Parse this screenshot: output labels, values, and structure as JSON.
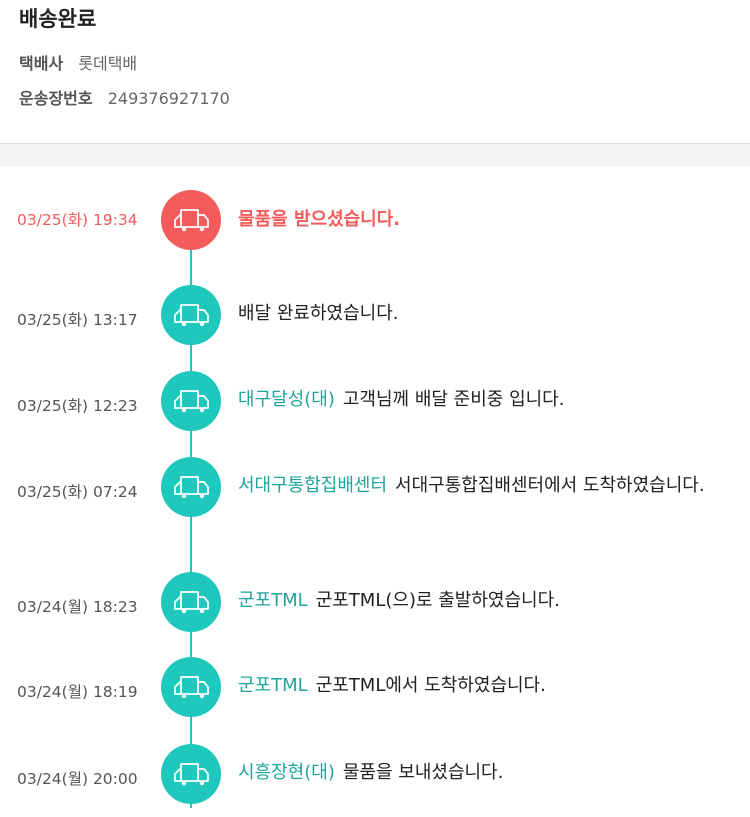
{
  "header": {
    "status_title": "배송완료",
    "carrier_label": "택배사",
    "carrier_value": "롯데택배",
    "tracking_label": "운송장번호",
    "tracking_value": "249376927170"
  },
  "colors": {
    "accent_teal": "#1fc8bd",
    "location_teal": "#1fa59c",
    "current_red": "#f45b5b"
  },
  "events": [
    {
      "time": "03/25(화) 19:34",
      "location": "",
      "message": "물품을 받으셨습니다.",
      "icon": "truck-icon",
      "current": true
    },
    {
      "time": "03/25(화) 13:17",
      "location": "",
      "message": "배달 완료하였습니다.",
      "icon": "truck-icon",
      "current": false
    },
    {
      "time": "03/25(화) 12:23",
      "location": "대구달성(대)",
      "message": "고객님께 배달 준비중 입니다.",
      "icon": "truck-icon",
      "current": false
    },
    {
      "time": "03/25(화) 07:24",
      "location": "서대구통합집배센터",
      "message": "서대구통합집배센터에서 도착하였습니다.",
      "icon": "truck-icon",
      "current": false
    },
    {
      "time": "03/24(월) 18:23",
      "location": "군포TML",
      "message": "군포TML(으)로 출발하였습니다.",
      "icon": "truck-icon",
      "current": false
    },
    {
      "time": "03/24(월) 18:19",
      "location": "군포TML",
      "message": "군포TML에서 도착하였습니다.",
      "icon": "truck-icon",
      "current": false
    },
    {
      "time": "03/24(월) 20:00",
      "location": "시흥장현(대)",
      "message": "물품을 보내셨습니다.",
      "icon": "truck-icon",
      "current": false
    }
  ]
}
